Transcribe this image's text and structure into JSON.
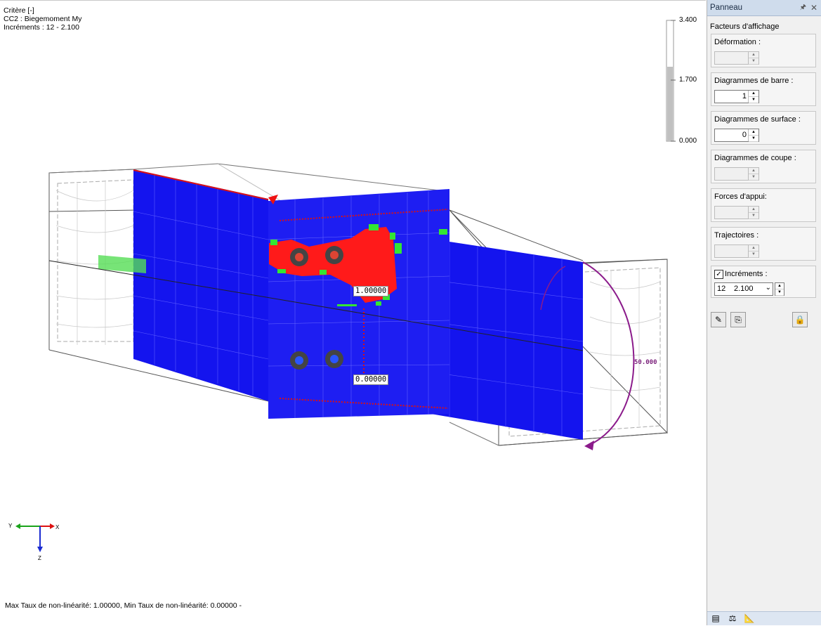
{
  "viewport": {
    "info_lines": [
      "Critère [-]",
      "CC2 : Biegemoment My",
      "Incréments : 12 - 2.100"
    ],
    "color_scale": {
      "max": "3.400",
      "mid": "1.700",
      "min": "0.000",
      "fill_fraction": 0.68
    },
    "result_labels": {
      "max_value": "1.00000",
      "min_value": "0.00000"
    },
    "moment_label": "50.000",
    "axes": {
      "y": "Y",
      "x": "X",
      "z": "Z"
    },
    "status": "Max Taux de non-linéarité: 1.00000, Min Taux de non-linéarité: 0.00000 -",
    "colors": {
      "plate": "#1414ee",
      "plastic": "#ff1a1a",
      "elastic_limit": "#33e633",
      "moment_arrow": "#8b1b8b",
      "load": "#55dd55"
    }
  },
  "panel": {
    "title": "Panneau",
    "pin_icon": "pin-icon",
    "close_icon": "close-icon",
    "section": "Facteurs d'affichage",
    "groups": [
      {
        "label": "Déformation :",
        "value": "",
        "enabled": false
      },
      {
        "label": "Diagrammes de barre :",
        "value": "1",
        "enabled": true
      },
      {
        "label": "Diagrammes de surface :",
        "value": "0",
        "enabled": true
      },
      {
        "label": "Diagrammes de coupe :",
        "value": "",
        "enabled": false
      },
      {
        "label": "Forces d'appui:",
        "value": "",
        "enabled": false
      },
      {
        "label": "Trajectoires :",
        "value": "",
        "enabled": false
      }
    ],
    "increments": {
      "label": "Incréments :",
      "checked": true,
      "index": "12",
      "value": "2.100"
    },
    "tools": [
      "edit-icon",
      "copy-icon",
      "lock-icon"
    ],
    "bottom_tabs": [
      "color-scale-icon",
      "balance-icon",
      "measure-icon"
    ]
  }
}
